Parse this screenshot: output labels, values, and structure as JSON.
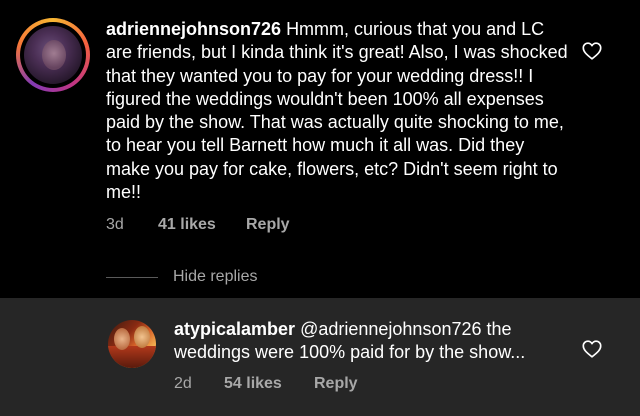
{
  "comment": {
    "username": "adriennejohnson726",
    "text": "Hmmm, curious that you and LC are friends, but I kinda think it's great! Also, I was shocked that they wanted you to pay for your wedding dress!! I figured the weddings wouldn't been 100% all expenses paid by the show. That was actually quite shocking to me, to hear you tell Barnett how much it all was. Did they make you pay for cake, flowers, etc? Didn't seem right to me!!",
    "time": "3d",
    "likes": "41 likes",
    "reply_label": "Reply",
    "avatar_icon": "profile-photo",
    "like_icon": "heart-outline-icon"
  },
  "hide_replies": "Hide replies",
  "reply": {
    "username": "atypicalamber",
    "text": "@adriennejohnson726 the weddings were 100% paid for by the show...",
    "time": "2d",
    "likes": "54 likes",
    "reply_label": "Reply",
    "avatar_icon": "profile-photo",
    "like_icon": "heart-outline-icon"
  },
  "colors": {
    "background": "#000000",
    "reply_background": "#262626",
    "primary_text": "#ffffff",
    "secondary_text": "#a8a8a8",
    "story_ring": [
      "#f7b733",
      "#f56040",
      "#c13584",
      "#833ab4"
    ]
  }
}
